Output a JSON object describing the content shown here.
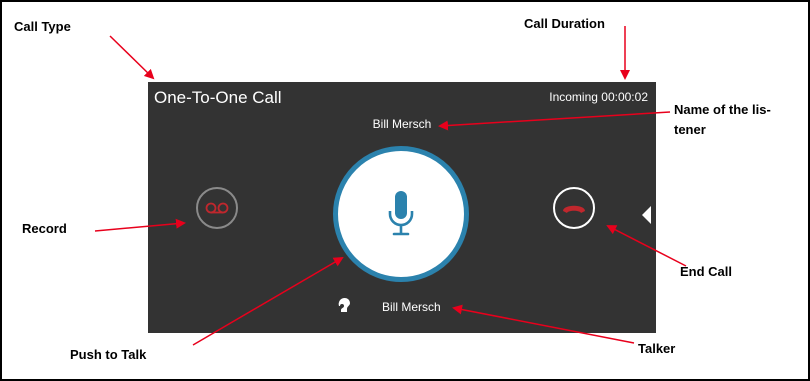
{
  "screen": {
    "call_type": "One-To-One Call",
    "call_duration": "Incoming 00:00:02",
    "listener_name": "Bill Mersch",
    "talker_name": "Bill Mersch"
  },
  "icons": {
    "record": "voicemail-icon",
    "push_to_talk": "microphone-icon",
    "end_call": "phone-hangup-icon",
    "talker": "talker-icon",
    "expand": "chevron-left-icon"
  },
  "annotations": {
    "call_type": "Call Type",
    "call_duration": "Call Duration",
    "listener": "Name of the lis-\ntener",
    "record": "Record",
    "end_call": "End Call",
    "push_to_talk": "Push to Talk",
    "talker": "Talker"
  },
  "colors": {
    "screen_bg": "#333333",
    "ptt_ring": "#2b82ad",
    "mic": "#2b82ad",
    "record_icon": "#c0272d",
    "end_call_icon": "#c0272d",
    "arrow": "#e8001c"
  }
}
